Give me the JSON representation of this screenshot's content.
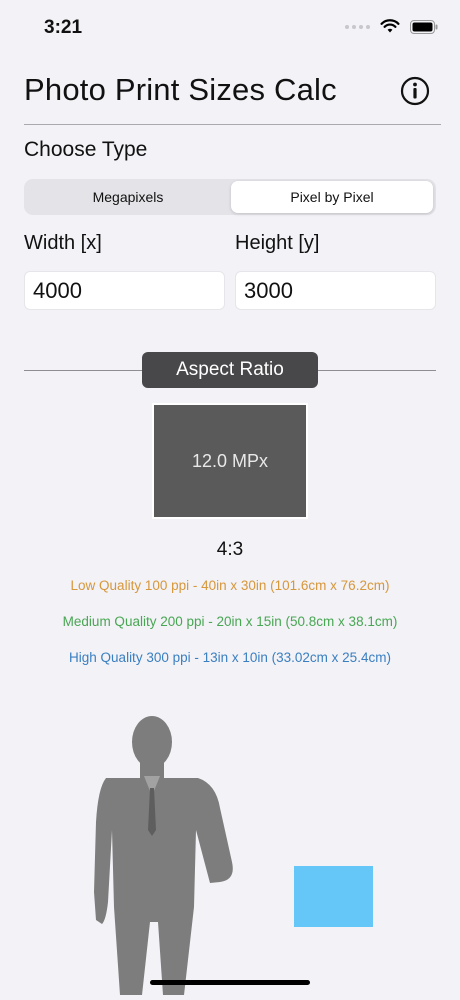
{
  "status_bar": {
    "time": "3:21",
    "signal_icon": "cellular-dots-icon",
    "wifi_icon": "wifi-icon",
    "battery_icon": "battery-icon"
  },
  "header": {
    "title": "Photo Print Sizes Calc",
    "info_icon": "info-icon"
  },
  "choose_type": {
    "label": "Choose Type",
    "options": [
      "Megapixels",
      "Pixel by Pixel"
    ],
    "selected": "Pixel by Pixel"
  },
  "inputs": {
    "width_label": "Width [x]",
    "width_value": "4000",
    "height_label": "Height [y]",
    "height_value": "3000"
  },
  "aspect_ratio": {
    "button_label": "Aspect Ratio",
    "megapixels": "12.0 MPx",
    "ratio": "4:3"
  },
  "quality": {
    "low": "Low Quality 100 ppi - 40in x 30in (101.6cm x 76.2cm)",
    "medium": "Medium Quality 200 ppi - 20in x 15in (50.8cm x 38.1cm)",
    "high": "High Quality 300 ppi - 13in x 10in (33.02cm x 25.4cm)"
  },
  "colors": {
    "low": "#d7973b",
    "medium": "#49a653",
    "high": "#3a7fc1",
    "print_preview": "#65c7f8"
  },
  "comparison": {
    "person_icon": "person-silhouette-icon"
  }
}
